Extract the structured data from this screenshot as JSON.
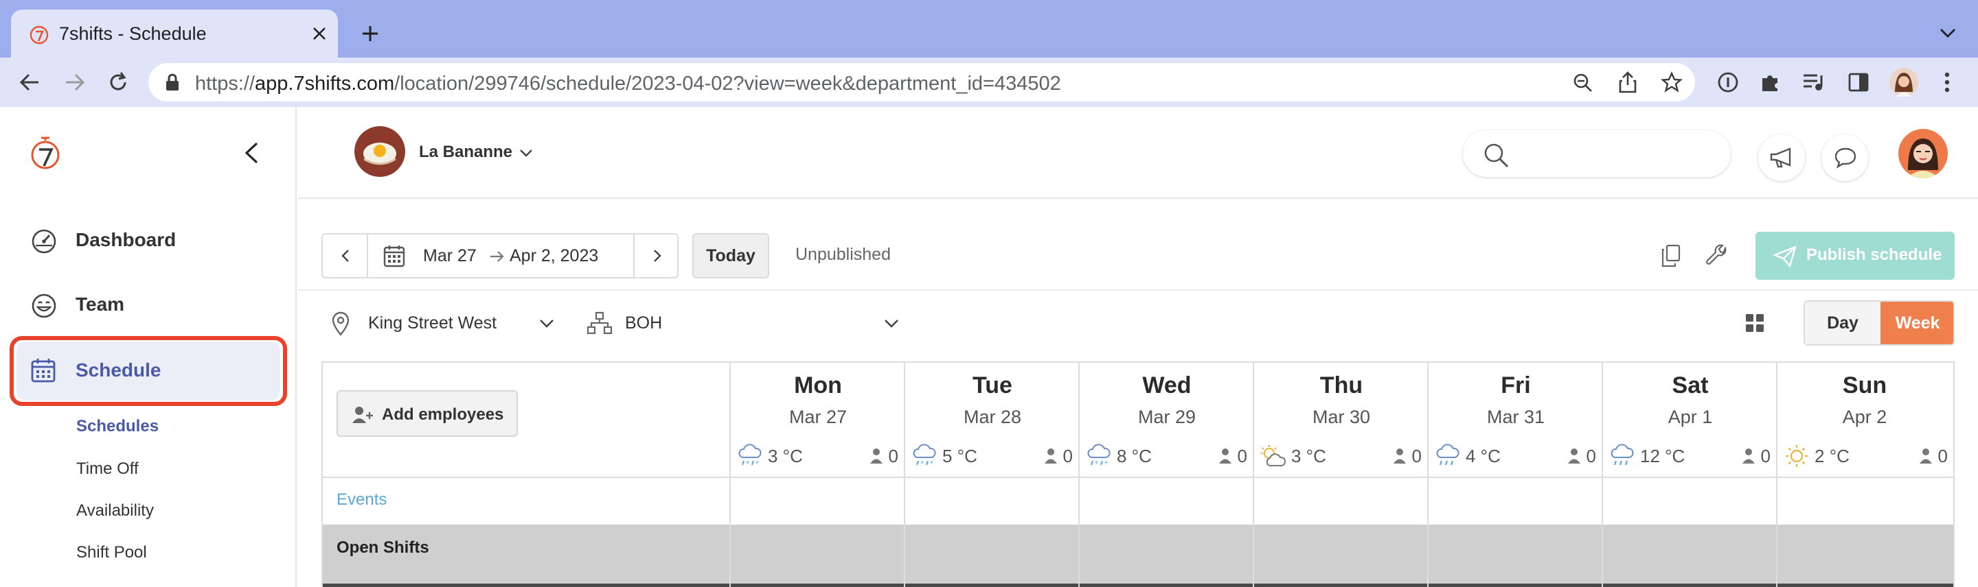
{
  "browser": {
    "tab_title": "7shifts - Schedule",
    "url_scheme": "https://",
    "url_host": "app.7shifts.com",
    "url_path": "/location/299746/schedule/2023-04-02?view=week&department_id=434502"
  },
  "sidebar": {
    "items": [
      {
        "label": "Dashboard",
        "icon": "dashboard-gauge-icon"
      },
      {
        "label": "Team",
        "icon": "team-smiley-icon"
      },
      {
        "label": "Schedule",
        "icon": "calendar-icon",
        "active": true
      }
    ],
    "sub_items": [
      "Schedules",
      "Time Off",
      "Availability",
      "Shift Pool"
    ],
    "highlight_color": "#e8412c",
    "active_color": "#4a5aa8"
  },
  "header": {
    "company_name": "La Bananne"
  },
  "toolbar": {
    "date_start": "Mar 27",
    "date_end": "Apr 2, 2023",
    "today_label": "Today",
    "status": "Unpublished",
    "publish_label": "Publish schedule",
    "publish_color": "#9fdcd2"
  },
  "filters": {
    "location": "King Street West",
    "department": "BOH",
    "view_day": "Day",
    "view_week": "Week",
    "accent_color": "#f07f4e"
  },
  "schedule": {
    "add_employees_label": "Add employees",
    "events_label": "Events",
    "open_shifts_label": "Open Shifts",
    "days": [
      {
        "name": "Mon",
        "date": "Mar 27",
        "temp": "3 °C",
        "weather": "sleet",
        "count": "0"
      },
      {
        "name": "Tue",
        "date": "Mar 28",
        "temp": "5 °C",
        "weather": "sleet",
        "count": "0"
      },
      {
        "name": "Wed",
        "date": "Mar 29",
        "temp": "8 °C",
        "weather": "sleet",
        "count": "0"
      },
      {
        "name": "Thu",
        "date": "Mar 30",
        "temp": "3 °C",
        "weather": "partly-cloudy",
        "count": "0"
      },
      {
        "name": "Fri",
        "date": "Mar 31",
        "temp": "4 °C",
        "weather": "rain",
        "count": "0"
      },
      {
        "name": "Sat",
        "date": "Apr 1",
        "temp": "12 °C",
        "weather": "rain",
        "count": "0"
      },
      {
        "name": "Sun",
        "date": "Apr 2",
        "temp": "2 °C",
        "weather": "sunny",
        "count": "0"
      }
    ]
  }
}
